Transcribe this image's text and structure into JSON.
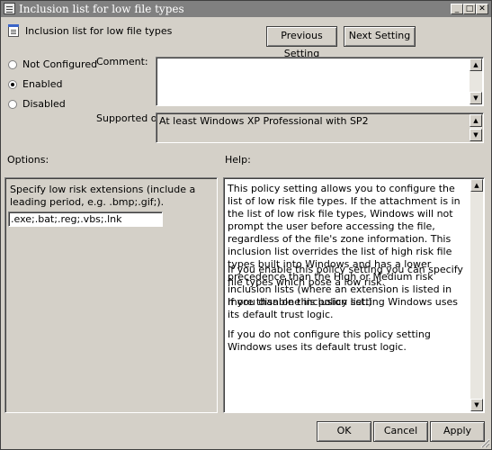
{
  "window": {
    "title": "Inclusion list for low file types"
  },
  "header": {
    "setting_name": "Inclusion list for low file types",
    "previous_button": "Previous Setting",
    "next_button": "Next Setting"
  },
  "state": {
    "not_configured": "Not Configured",
    "enabled": "Enabled",
    "disabled": "Disabled",
    "selected": "enabled"
  },
  "comment": {
    "label": "Comment:",
    "value": ""
  },
  "supported": {
    "label": "Supported on:",
    "value": "At least Windows XP Professional with SP2"
  },
  "options": {
    "label": "Options:",
    "description": "Specify low risk extensions (include a leading period, e.g. .bmp;.gif;).",
    "field_value": ".exe;.bat;.reg;.vbs;.lnk"
  },
  "help": {
    "label": "Help:",
    "paragraphs": [
      "This policy setting allows you to configure the list of low risk file types. If the attachment is in the list of low risk file types, Windows will not prompt the user before accessing the file, regardless of the file's zone information. This inclusion list overrides the list of high risk file types built into Windows and has a lower precedence than the High or Medium risk inclusion lists (where an extension is listed in more than one inclusion list.)",
      "If you enable this policy setting you can specify file types which pose a low risk.",
      "If you disable this policy setting Windows uses its default trust logic.",
      "If you do not configure this policy setting Windows uses its default trust logic."
    ]
  },
  "footer": {
    "ok": "OK",
    "cancel": "Cancel",
    "apply": "Apply"
  },
  "icons": {
    "window": "policy-document-icon",
    "minimize": "minimize-icon",
    "maximize": "maximize-icon",
    "close": "close-icon",
    "scroll_up": "scroll-up-arrow-icon",
    "scroll_down": "scroll-down-arrow-icon",
    "resize": "resize-grip-icon"
  }
}
